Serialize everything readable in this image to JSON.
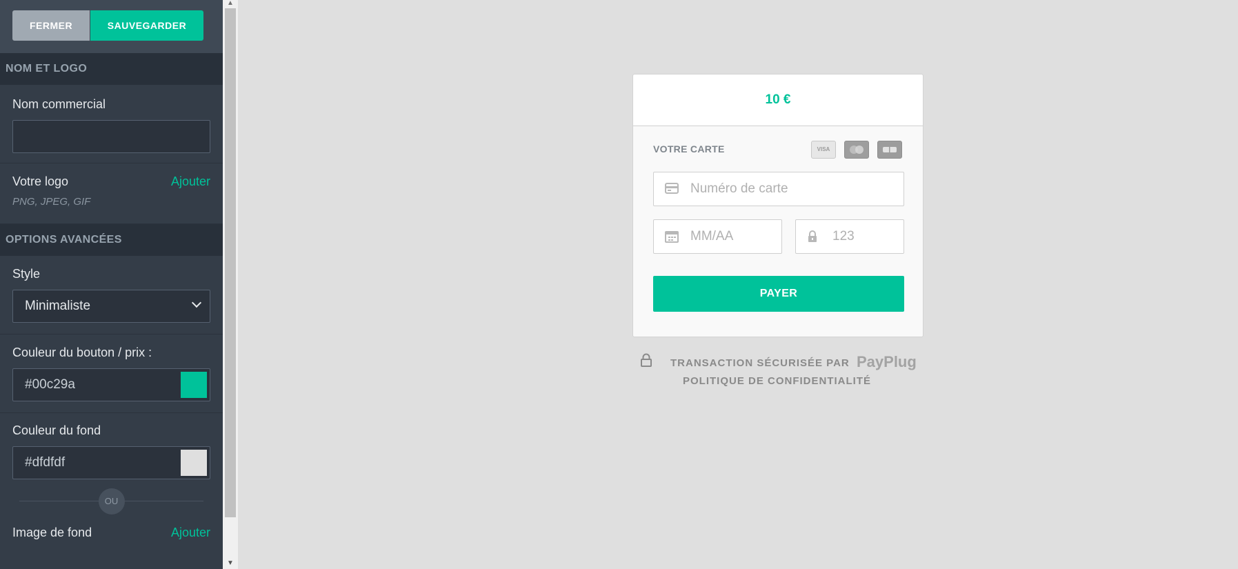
{
  "toolbar": {
    "close_label": "FERMER",
    "save_label": "SAUVEGARDER"
  },
  "sections": {
    "name_logo": "NOM ET LOGO",
    "advanced": "OPTIONS AVANCÉES"
  },
  "fields": {
    "trade_name": {
      "label": "Nom commercial",
      "value": ""
    },
    "logo": {
      "label": "Votre logo",
      "action": "Ajouter",
      "hint": "PNG, JPEG, GIF"
    },
    "style": {
      "label": "Style",
      "value": "Minimaliste"
    },
    "button_color": {
      "label": "Couleur du bouton / prix :",
      "value": "#00c29a"
    },
    "bg_color": {
      "label": "Couleur du fond",
      "value": "#dfdfdf"
    },
    "or": "OU",
    "bg_image": {
      "label": "Image de fond",
      "action": "Ajouter"
    }
  },
  "colors": {
    "accent": "#00c29a",
    "background": "#dfdfdf"
  },
  "payment": {
    "amount": "10 €",
    "card_label": "VOTRE CARTE",
    "card_icons": [
      "visa-icon",
      "mastercard-icon",
      "cb-icon"
    ],
    "card_number_placeholder": "Numéro de carte",
    "expiry_placeholder": "MM/AA",
    "cvc_placeholder": "123",
    "pay_label": "PAYER",
    "secured_text": "TRANSACTION SÉCURISÉE PAR",
    "brand": "PayPlug",
    "privacy": "POLITIQUE DE CONFIDENTIALITÉ"
  }
}
